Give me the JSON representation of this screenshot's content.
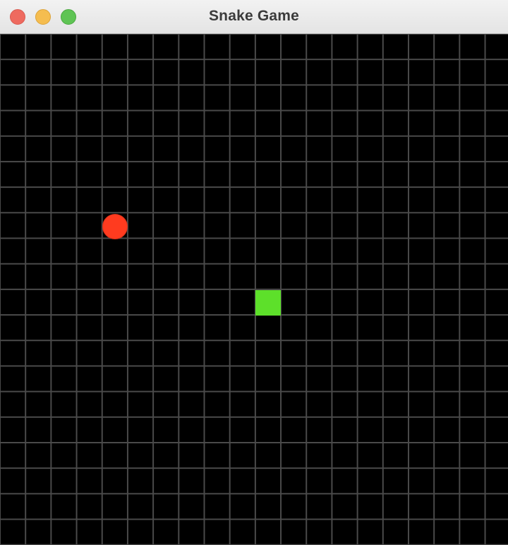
{
  "window": {
    "title": "Snake Game"
  },
  "controls": {
    "close": "close-button",
    "minimize": "minimize-button",
    "zoom": "zoom-button"
  },
  "game": {
    "grid": {
      "columns": 20,
      "rows": 20,
      "line_color": "#4a4a4a",
      "background_color": "#000000"
    },
    "food": {
      "shape": "circle",
      "color": "#ff3b1f",
      "cell": [
        4,
        7
      ]
    },
    "snake": {
      "color": "#5de02a",
      "segments": [
        [
          10,
          10
        ]
      ]
    }
  }
}
